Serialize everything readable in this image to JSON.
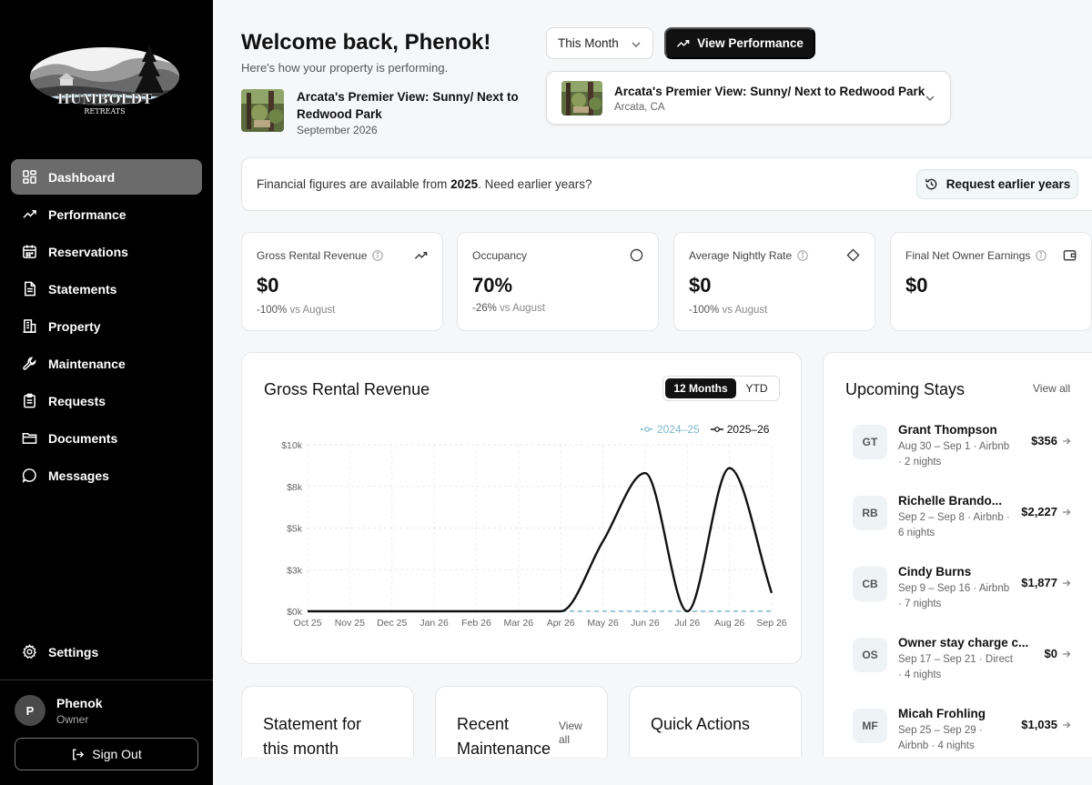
{
  "brand": {
    "name": "HUMBOLDT",
    "tagline": "RETREATS"
  },
  "nav": [
    {
      "label": "Dashboard",
      "icon": "dashboard-icon",
      "active": true
    },
    {
      "label": "Performance",
      "icon": "trending-up-icon"
    },
    {
      "label": "Reservations",
      "icon": "calendar-icon"
    },
    {
      "label": "Statements",
      "icon": "document-icon"
    },
    {
      "label": "Property",
      "icon": "building-icon"
    },
    {
      "label": "Maintenance",
      "icon": "wrench-icon"
    },
    {
      "label": "Requests",
      "icon": "clipboard-icon"
    },
    {
      "label": "Documents",
      "icon": "folder-icon"
    },
    {
      "label": "Messages",
      "icon": "chat-icon"
    }
  ],
  "settings_label": "Settings",
  "user": {
    "initial": "P",
    "name": "Phenok",
    "role": "Owner",
    "signout_label": "Sign Out"
  },
  "header": {
    "welcome": "Welcome back, Phenok!",
    "subtitle": "Here's how your property is performing.",
    "property_title": "Arcata's Premier View: Sunny/ Next to Redwood Park",
    "property_date": "September 2026",
    "period_label": "This Month",
    "view_performance_label": "View Performance"
  },
  "property_select": {
    "title": "Arcata's Premier View: Sunny/ Next to Redwood Park",
    "location": "Arcata, CA"
  },
  "banner": {
    "text_before": "Financial figures are available from ",
    "year": "2025",
    "text_after": ". Need earlier years?",
    "button_label": "Request earlier years"
  },
  "stats": [
    {
      "label": "Gross Rental Revenue",
      "value": "$0",
      "change": "-100%",
      "vs": " vs August",
      "icon": "trending-up-icon",
      "info": true
    },
    {
      "label": "Occupancy",
      "value": "70%",
      "change": "-26%",
      "vs": " vs August",
      "icon": "circle-icon",
      "info": false
    },
    {
      "label": "Average Nightly Rate",
      "value": "$0",
      "change": "-100%",
      "vs": " vs August",
      "icon": "diamond-icon",
      "info": true
    },
    {
      "label": "Final Net Owner Earnings",
      "value": "$0",
      "change": "",
      "vs": "",
      "icon": "wallet-icon",
      "info": true
    }
  ],
  "chart": {
    "title": "Gross Rental Revenue",
    "toggle_on": "12 Months",
    "toggle_off": "YTD"
  },
  "chart_data": {
    "type": "line",
    "title": "Gross Rental Revenue",
    "categories": [
      "Oct 25",
      "Nov 25",
      "Dec 25",
      "Jan 26",
      "Feb 26",
      "Mar 26",
      "Apr 26",
      "May 26",
      "Jun 26",
      "Jul 26",
      "Aug 26",
      "Sep 26"
    ],
    "y_ticks": [
      "$0k",
      "$3k",
      "$5k",
      "$8k",
      "$10k"
    ],
    "ylim": [
      0,
      10000
    ],
    "grid": true,
    "legend_position": "top-right",
    "series": [
      {
        "name": "2024–25",
        "color": "#7fb8cc",
        "dashed": true,
        "values": [
          0,
          0,
          0,
          0,
          0,
          0,
          0,
          0,
          0,
          0,
          0,
          0
        ]
      },
      {
        "name": "2025–26",
        "color": "#111111",
        "dashed": false,
        "values": [
          0,
          0,
          0,
          0,
          0,
          0,
          0,
          4200,
          8300,
          0,
          8600,
          1100
        ]
      }
    ]
  },
  "stays": {
    "title": "Upcoming Stays",
    "view_all": "View all",
    "items": [
      {
        "initials": "GT",
        "name": "Grant Thompson",
        "meta": "Aug 30 – Sep 1 · Airbnb · 2 nights",
        "price": "$356"
      },
      {
        "initials": "RB",
        "name": "Richelle Brando...",
        "meta": "Sep 2 – Sep 8 · Airbnb · 6 nights",
        "price": "$2,227"
      },
      {
        "initials": "CB",
        "name": "Cindy Burns",
        "meta": "Sep 9 – Sep 16 · Airbnb · 7 nights",
        "price": "$1,877"
      },
      {
        "initials": "OS",
        "name": "Owner stay charge c...",
        "meta": "Sep 17 – Sep 21 · Direct · 4 nights",
        "price": "$0"
      },
      {
        "initials": "MF",
        "name": "Micah Frohling",
        "meta": "Sep 25 – Sep 29 · Airbnb · 4 nights",
        "price": "$1,035"
      }
    ]
  },
  "bottom_cards": {
    "statement_title": "Statement for this month",
    "maintenance_title": "Recent Maintenance",
    "maintenance_link": "View all",
    "quick_actions_title": "Quick Actions"
  }
}
